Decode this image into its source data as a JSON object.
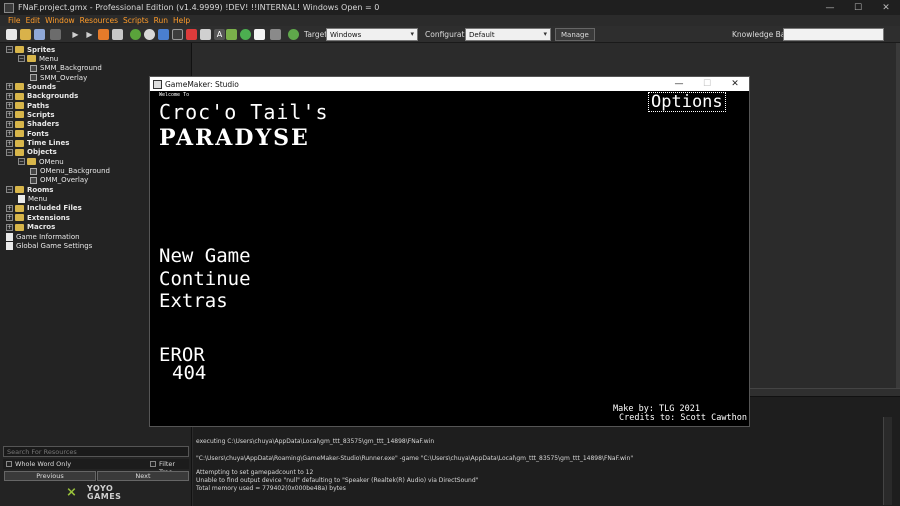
{
  "titlebar": {
    "title": "FNaF.project.gmx  -  Professional Edition (v1.4.9999)  !DEV! !!INTERNAL! Windows Open = 0",
    "minimize": "—",
    "maximize": "☐",
    "close": "✕"
  },
  "menu": {
    "items": [
      "File",
      "Edit",
      "Window",
      "Resources",
      "Scripts",
      "Run",
      "Help"
    ]
  },
  "toolbar": {
    "target_label": "Target",
    "target_value": "Windows",
    "configuration_label": "Configuration",
    "configuration_value": "Default",
    "manage_label": "Manage",
    "knowledge_label": "Knowledge Base:"
  },
  "resource_tree": [
    {
      "label": "Sprites",
      "bold": true,
      "expanded": true,
      "kind": "folder"
    },
    {
      "label": "Menu",
      "bold": false,
      "expanded": true,
      "kind": "folder"
    },
    {
      "label": "SMM_Background",
      "bold": false,
      "kind": "sprite"
    },
    {
      "label": "SMM_Overlay",
      "bold": false,
      "kind": "sprite"
    },
    {
      "label": "Sounds",
      "bold": true,
      "kind": "folder"
    },
    {
      "label": "Backgrounds",
      "bold": true,
      "kind": "folder"
    },
    {
      "label": "Paths",
      "bold": true,
      "kind": "folder"
    },
    {
      "label": "Scripts",
      "bold": true,
      "kind": "folder"
    },
    {
      "label": "Shaders",
      "bold": true,
      "kind": "folder"
    },
    {
      "label": "Fonts",
      "bold": true,
      "kind": "folder"
    },
    {
      "label": "Time Lines",
      "bold": true,
      "kind": "folder"
    },
    {
      "label": "Objects",
      "bold": true,
      "expanded": true,
      "kind": "folder"
    },
    {
      "label": "OMenu",
      "bold": false,
      "expanded": true,
      "kind": "folder"
    },
    {
      "label": "OMenu_Background",
      "bold": false,
      "kind": "sprite"
    },
    {
      "label": "OMM_Overlay",
      "bold": false,
      "kind": "sprite"
    },
    {
      "label": "Rooms",
      "bold": true,
      "expanded": true,
      "kind": "folder"
    },
    {
      "label": "Menu",
      "bold": false,
      "kind": "doc"
    },
    {
      "label": "Included Files",
      "bold": true,
      "kind": "folder"
    },
    {
      "label": "Extensions",
      "bold": true,
      "kind": "folder"
    },
    {
      "label": "Macros",
      "bold": true,
      "kind": "folder"
    },
    {
      "label": "Game Information",
      "bold": false,
      "kind": "doc"
    },
    {
      "label": "Global Game Settings",
      "bold": false,
      "kind": "doc"
    }
  ],
  "search": {
    "placeholder": "Search For Resources",
    "whole_word_label": "Whole Word Only",
    "filter_label": "Filter Tree",
    "previous_label": "Previous",
    "next_label": "Next"
  },
  "branding": {
    "yoyo_top": "YOYO",
    "yoyo_bottom": "GAMES"
  },
  "output": {
    "lines": [
      "executing C:\\Users\\chuya\\AppData\\Local\\gm_ttt_83575\\gm_ttt_14898\\FNaF.win",
      "\"C:\\Users\\chuya\\AppData\\Roaming\\GameMaker-Studio\\Runner.exe\" -game \"C:\\Users\\chuya\\AppData\\Local\\gm_ttt_83575\\gm_ttt_14898\\FNaF.win\"",
      "Attempting to set gamepadcount to 12",
      "Unable to find output device \"null\" defaulting to \"Speaker (Realtek(R) Audio) via DirectSound\"",
      "Total memory used = 779402(0x000be48a) bytes"
    ]
  },
  "game_window": {
    "title": "GameMaker: Studio",
    "welcome": "Welcome To",
    "game_title": "Croc'o Tail's",
    "logo": "PARADYSE",
    "options": "Options",
    "new_game": "New Game",
    "continue": "Continue",
    "extras": "Extras",
    "error_line1": "EROR",
    "error_line2": "404",
    "credit_line1": "Make by: TLG 2021",
    "credit_line2": "Credits to: Scott Cawthon"
  }
}
